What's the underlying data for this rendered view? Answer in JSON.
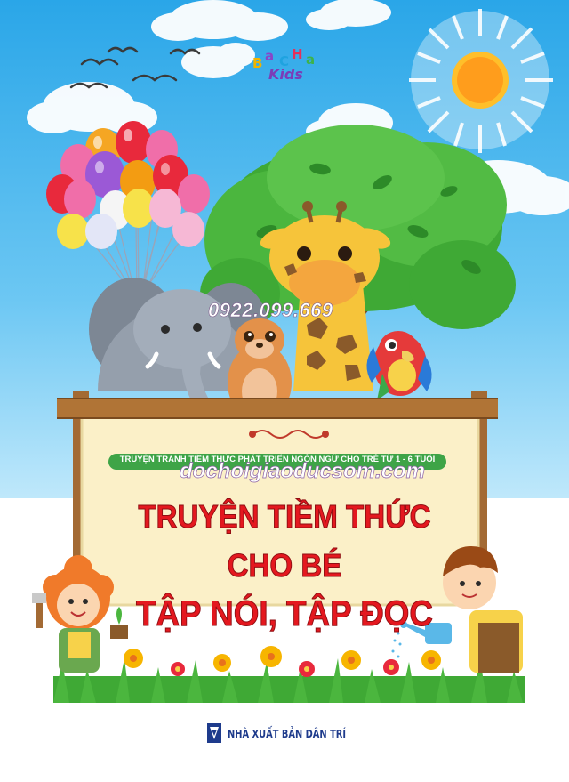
{
  "logo": {
    "letters": [
      "B",
      "a",
      "C",
      "H",
      "a"
    ],
    "sub": "Kids"
  },
  "phone": "0922.099.669",
  "series_subtitle": "TRUYỆN TRANH TIỀM THỨC PHÁT TRIỂN NGÔN NGỮ CHO TRẺ TỪ 1 - 6 TUỔI",
  "website": "dochoigiaoducsom.com",
  "title": {
    "line1": "TRUYỆN TIỀM THỨC",
    "line2": "CHO BÉ",
    "line3": "TẬP NÓI, TẬP ĐỌC"
  },
  "publisher": "NHÀ XUẤT BẢN DÂN TRÍ",
  "colors": {
    "sky_top": "#2aa6e8",
    "sky_bottom": "#bfe8fb",
    "title_red": "#e4181f",
    "subtitle_green": "#3ea447",
    "publisher_blue": "#1e3b8c",
    "board": "#fbf0c8"
  },
  "icons": [
    "sun-icon",
    "bird-icon",
    "balloon-icon",
    "elephant-icon",
    "giraffe-icon",
    "meerkat-icon",
    "parrot-icon",
    "tree-icon",
    "flower-icon",
    "watering-can-icon",
    "publisher-logo-icon"
  ]
}
